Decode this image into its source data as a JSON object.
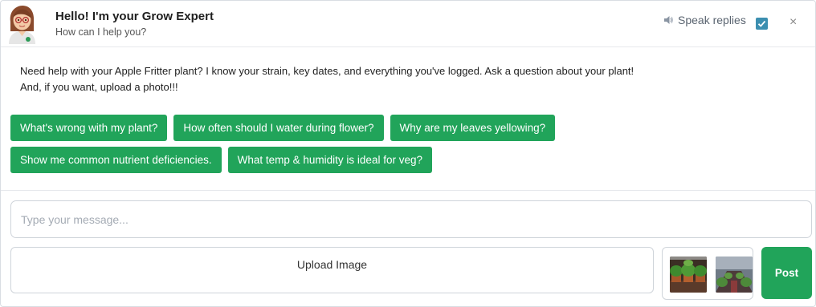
{
  "header": {
    "title": "Hello! I'm your Grow Expert",
    "subtitle": "How can I help you?",
    "speak_label": "Speak replies",
    "speak_checked": true,
    "close_label": "×"
  },
  "intro": "Need help with your Apple Fritter plant? I know your strain, key dates, and everything you've logged. Ask a question about your plant! And, if you want, upload a photo!!!",
  "suggestions": {
    "row1": [
      "What's wrong with my plant?",
      "How often should I water during flower?",
      "Why are my leaves yellowing?"
    ],
    "row2": [
      "Show me common nutrient deficiencies.",
      "What temp & humidity is ideal for veg?"
    ]
  },
  "composer": {
    "placeholder": "Type your message...",
    "value": "",
    "upload_label": "Upload Image",
    "post_label": "Post"
  },
  "colors": {
    "accent": "#21a45a",
    "checkbox": "#3c8fb0",
    "border": "#cfd4da"
  },
  "icons": {
    "avatar": "grow-expert-avatar-icon",
    "speaker": "speaker-icon",
    "checkbox": "checkmark-icon",
    "close": "close-icon"
  }
}
